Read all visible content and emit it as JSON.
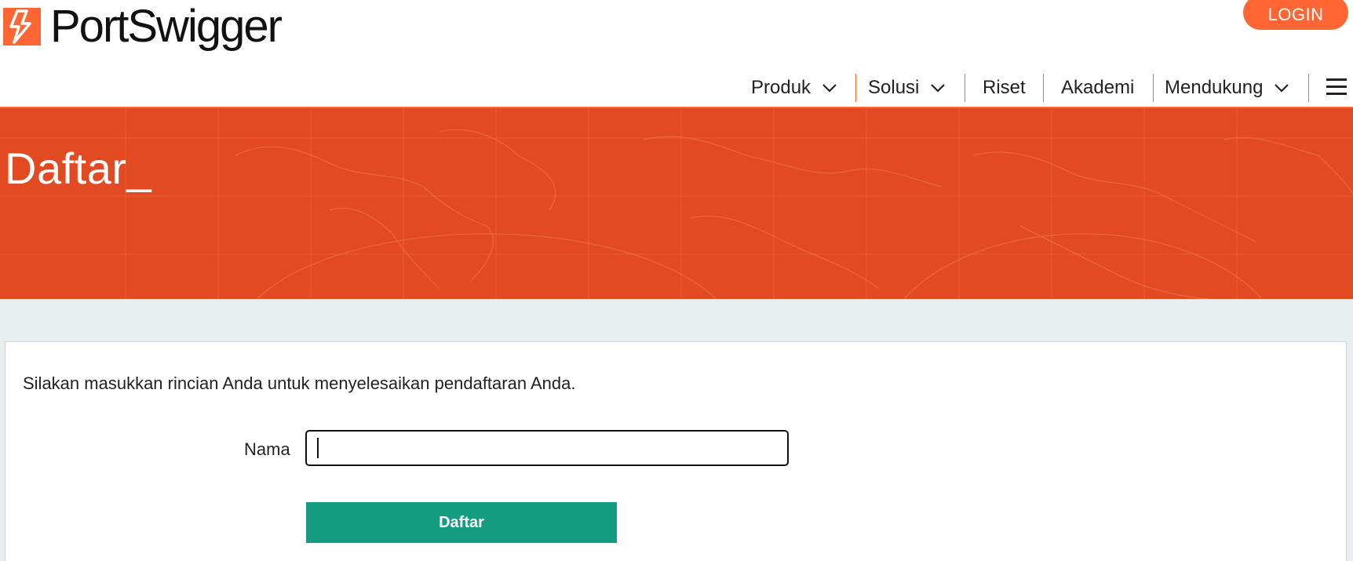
{
  "brand": {
    "name": "PortSwigger",
    "accent_color": "#ff6633",
    "hero_color": "#e24a21"
  },
  "header": {
    "login_label": "LOGIN",
    "nav": [
      {
        "label": "Produk",
        "dropdown": true
      },
      {
        "label": "Solusi",
        "dropdown": true
      },
      {
        "label": "Riset",
        "dropdown": false
      },
      {
        "label": "Akademi",
        "dropdown": false
      },
      {
        "label": "Mendukung",
        "dropdown": true
      }
    ],
    "menu_icon": "hamburger-icon"
  },
  "hero": {
    "title": "Daftar_"
  },
  "form": {
    "intro": "Silakan masukkan rincian Anda untuk menyelesaikan pendaftaran Anda.",
    "name_label": "Nama",
    "name_value": "",
    "submit_label": "Daftar",
    "submit_color": "#149b80"
  }
}
